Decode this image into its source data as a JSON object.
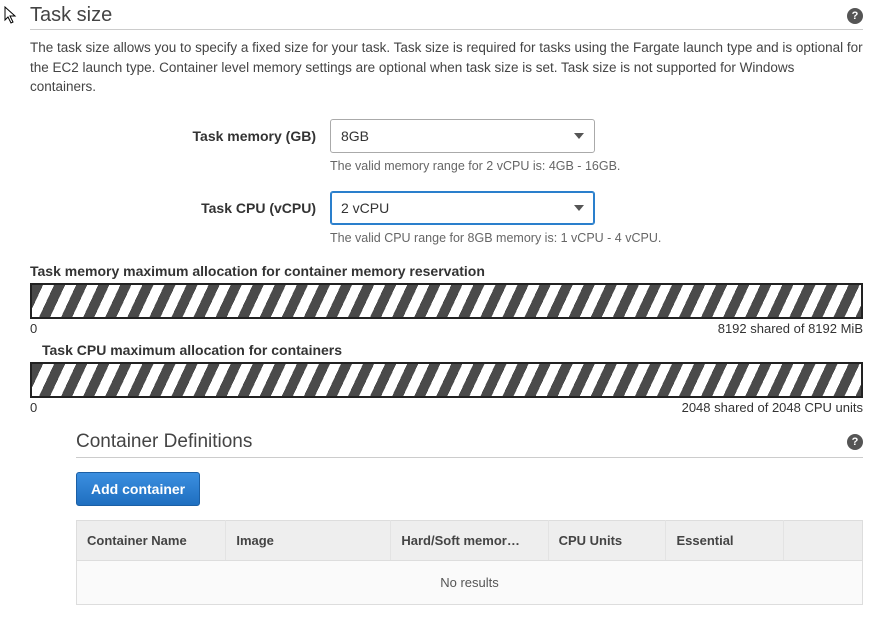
{
  "taskSize": {
    "title": "Task size",
    "description": "The task size allows you to specify a fixed size for your task. Task size is required for tasks using the Fargate launch type and is optional for the EC2 launch type. Container level memory settings are optional when task size is set. Task size is not supported for Windows containers.",
    "memory": {
      "label": "Task memory (GB)",
      "value": "8GB",
      "hint": "The valid memory range for 2 vCPU is: 4GB - 16GB."
    },
    "cpu": {
      "label": "Task CPU (vCPU)",
      "value": "2 vCPU",
      "hint": "The valid CPU range for 8GB memory is: 1 vCPU - 4 vCPU."
    },
    "memAlloc": {
      "label": "Task memory maximum allocation for container memory reservation",
      "zero": "0",
      "status": "8192 shared of 8192 MiB"
    },
    "cpuAlloc": {
      "label": "Task CPU maximum allocation for containers",
      "zero": "0",
      "status": "2048 shared of 2048 CPU units"
    }
  },
  "containers": {
    "title": "Container Definitions",
    "addButton": "Add container",
    "columns": {
      "name": "Container Name",
      "image": "Image",
      "memory": "Hard/Soft memor…",
      "cpu": "CPU Units",
      "essential": "Essential"
    },
    "empty": "No results"
  }
}
